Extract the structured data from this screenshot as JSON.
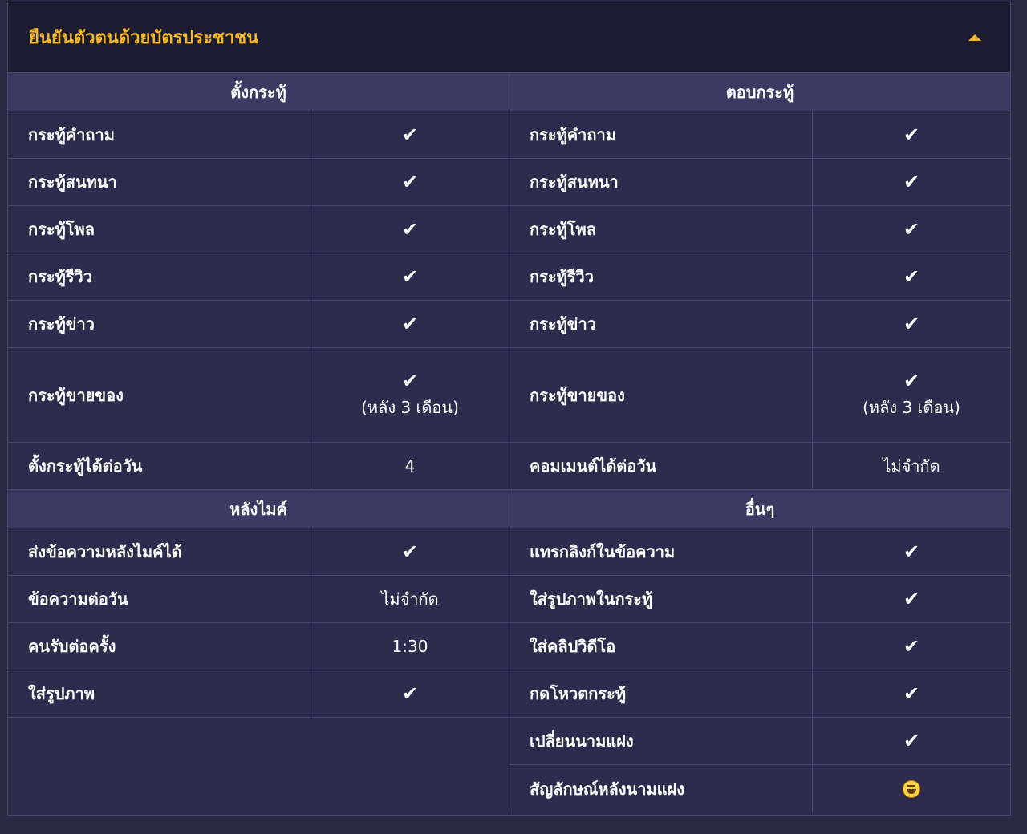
{
  "panel": {
    "title": "ยืนยันตัวตนด้วยบัตรประชาชน",
    "toggle_icon": "caret-up-icon",
    "accent_color": "#f5b829"
  },
  "left_top": {
    "header": "ตั้งกระทู้",
    "rows": [
      {
        "label": "กระทู้คำถาม",
        "check": "✔"
      },
      {
        "label": "กระทู้สนทนา",
        "check": "✔"
      },
      {
        "label": "กระทู้โพล",
        "check": "✔"
      },
      {
        "label": "กระทู้รีวิว",
        "check": "✔"
      },
      {
        "label": "กระทู้ข่าว",
        "check": "✔"
      },
      {
        "label": "กระทู้ขายของ",
        "check": "✔",
        "note": "(หลัง 3 เดือน)"
      },
      {
        "label": "ตั้งกระทู้ได้ต่อวัน",
        "value": "4"
      }
    ]
  },
  "right_top": {
    "header": "ตอบกระทู้",
    "rows": [
      {
        "label": "กระทู้คำถาม",
        "check": "✔"
      },
      {
        "label": "กระทู้สนทนา",
        "check": "✔"
      },
      {
        "label": "กระทู้โพล",
        "check": "✔"
      },
      {
        "label": "กระทู้รีวิว",
        "check": "✔"
      },
      {
        "label": "กระทู้ข่าว",
        "check": "✔"
      },
      {
        "label": "กระทู้ขายของ",
        "check": "✔",
        "note": "(หลัง 3 เดือน)"
      },
      {
        "label": "คอมเมนต์ได้ต่อวัน",
        "value": "ไม่จำกัด"
      }
    ]
  },
  "left_bottom": {
    "header": "หลังไมค์",
    "rows": [
      {
        "label": "ส่งข้อความหลังไมค์ได้",
        "check": "✔"
      },
      {
        "label": "ข้อความต่อวัน",
        "value": "ไม่จำกัด"
      },
      {
        "label": "คนรับต่อครั้ง",
        "value": "1:30"
      },
      {
        "label": "ใส่รูปภาพ",
        "check": "✔"
      }
    ]
  },
  "right_bottom": {
    "header": "อื่นๆ",
    "rows": [
      {
        "label": "แทรกลิงก์ในข้อความ",
        "check": "✔"
      },
      {
        "label": "ใส่รูปภาพในกระทู้",
        "check": "✔"
      },
      {
        "label": "ใส่คลิปวิดีโอ",
        "check": "✔"
      },
      {
        "label": "กดโหวตกระทู้",
        "check": "✔"
      },
      {
        "label": "เปลี่ยนนามแฝง",
        "check": "✔"
      },
      {
        "label": "สัญลักษณ์หลังนามแฝง",
        "icon": "laugh-emoji-icon"
      }
    ]
  }
}
